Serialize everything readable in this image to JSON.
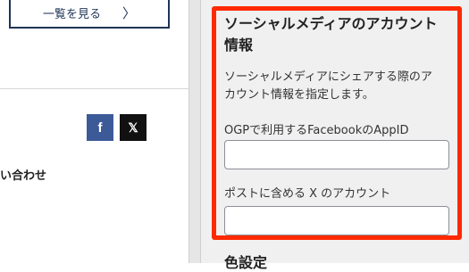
{
  "preview": {
    "view_list_label": "一覧を見る",
    "view_list_chevron": "〉",
    "facebook_glyph": "f",
    "x_glyph": "𝕏",
    "contact_text": "い合わせ"
  },
  "panel": {
    "section_title_line1": "ソーシャルメディアのアカウント",
    "section_title_line2": "情報",
    "description_line1": "ソーシャルメディアにシェアする際のア",
    "description_line2": "カウント情報を指定します。",
    "ogp_label": "OGPで利用するFacebookのAppID",
    "ogp_value": "",
    "x_account_label": "ポストに含める X のアカウント",
    "x_account_value": "",
    "next_section_title": "色設定"
  },
  "colors": {
    "highlight": "#ff2a00",
    "navy": "#1f3556",
    "facebook": "#3d5a98",
    "x": "#111111",
    "panel_bg": "#f0f0f1"
  }
}
